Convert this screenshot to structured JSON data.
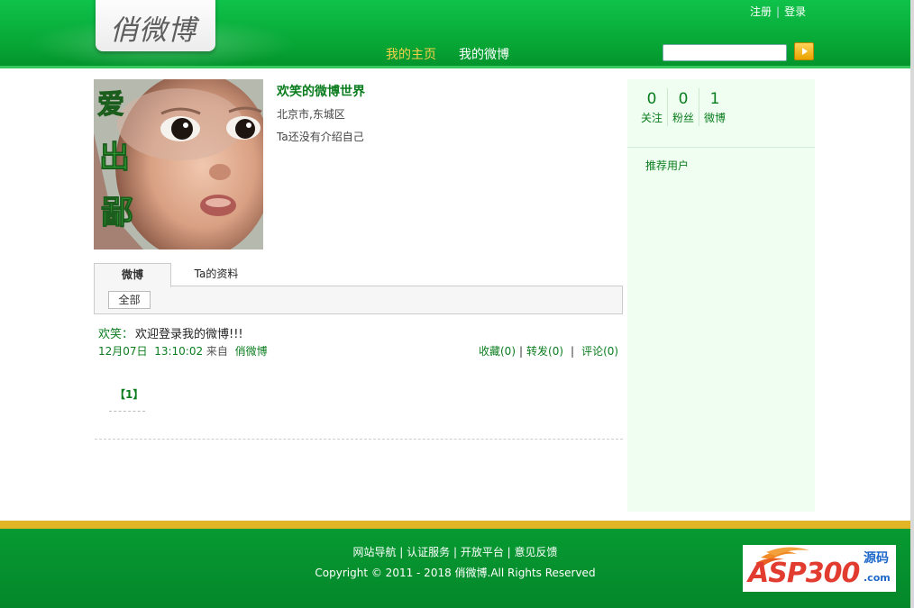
{
  "header": {
    "logo_text": "俏微博",
    "top_links": {
      "register": "注册",
      "separator": "|",
      "login": "登录"
    },
    "nav": {
      "home": "我的主页",
      "weibo": "我的微博"
    },
    "search": {
      "value": "",
      "placeholder": ""
    },
    "nav_active_color": "#f7d04a"
  },
  "profile": {
    "name": "欢笑的微博世界",
    "location": "北京市,东城区",
    "intro": "Ta还没有介绍自己"
  },
  "tabs": [
    {
      "label": "微博",
      "active": true
    },
    {
      "label": "Ta的资料",
      "active": false
    }
  ],
  "filter": {
    "label": "全部"
  },
  "post": {
    "author": "欢笑",
    "colon": "：",
    "text": "欢迎登录我的微博!!!",
    "date": "12月07日",
    "time": "13:10:02",
    "from_label": "来自",
    "source": "俏微博",
    "actions": {
      "favorite": "收藏(0)",
      "repost": "转发(0)",
      "comment": "评论(0)",
      "separator": "|"
    }
  },
  "pager": {
    "current": "【1】"
  },
  "sidebar": {
    "stats": [
      {
        "num": "0",
        "label": "关注"
      },
      {
        "num": "0",
        "label": "粉丝"
      },
      {
        "num": "1",
        "label": "微博"
      }
    ],
    "recommend": "推荐用户"
  },
  "footer": {
    "links": "网站导航 | 认证服务 | 开放平台 | 意见反馈",
    "copyright": "Copyright © 2011 - 2018 俏微博.All Rights Reserved",
    "badge": {
      "main": "ASP300",
      "sub": "源码",
      "com": ".com"
    }
  },
  "colors": {
    "brand_green": "#06a534",
    "link_green": "#0b7d1f",
    "footer_accent": "#e2b526",
    "sidebar_bg": "#effef1"
  }
}
